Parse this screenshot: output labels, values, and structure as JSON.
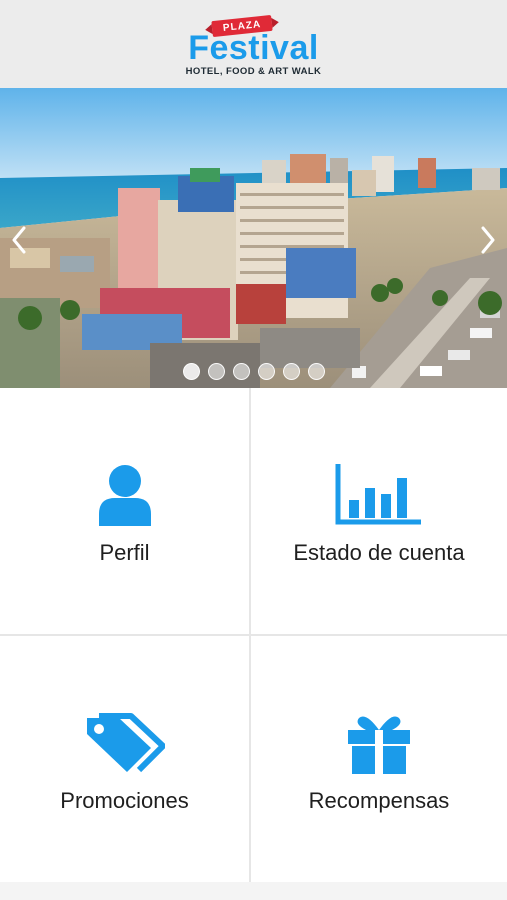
{
  "header": {
    "logo_badge": "PLAZA",
    "logo_name": "Festival",
    "logo_tagline": "HOTEL, FOOD & ART WALK"
  },
  "slider": {
    "dot_count": 6,
    "active_index": 0
  },
  "menu": {
    "perfil": "Perfil",
    "estado": "Estado de cuenta",
    "promociones": "Promociones",
    "recompensas": "Recompensas"
  },
  "colors": {
    "accent": "#1b9bea",
    "brand_red": "#e02a37"
  },
  "icons": {
    "perfil": "user-icon",
    "estado": "bar-chart-icon",
    "promociones": "tags-icon",
    "recompensas": "gift-icon"
  }
}
